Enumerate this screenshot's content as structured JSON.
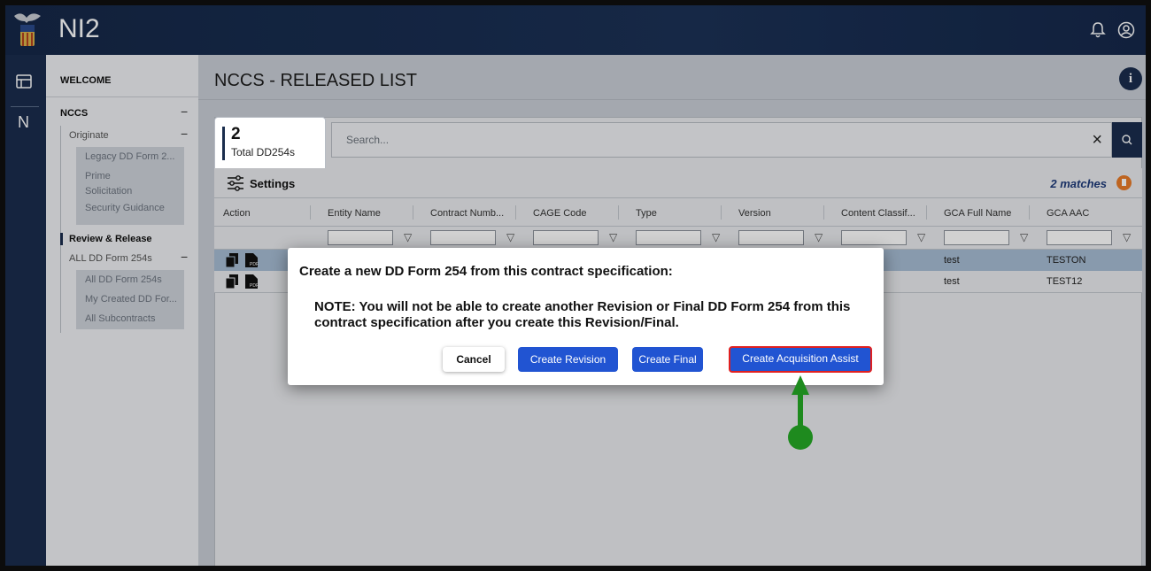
{
  "app": {
    "brand": "NI2"
  },
  "sidebar": {
    "welcome": "WELCOME",
    "nccs": "NCCS",
    "originate": "Originate",
    "originate_items": [
      "Legacy DD Form 2...",
      "Prime",
      "Solicitation",
      "Security Guidance"
    ],
    "review": "Review & Release",
    "all_dd": "ALL DD Form 254s",
    "all_dd_items": [
      "All DD Form 254s",
      "My Created DD For...",
      "All Subcontracts"
    ],
    "rail_letter": "N"
  },
  "main": {
    "title": "NCCS - RELEASED LIST",
    "info": "i",
    "count": "2",
    "count_label": "Total DD254s",
    "search_placeholder": "Search...",
    "clear": "×",
    "settings": "Settings",
    "matches": "2 matches"
  },
  "table": {
    "headers": [
      "Action",
      "Entity Name",
      "Contract Numb...",
      "CAGE Code",
      "Type",
      "Version",
      "Content Classif...",
      "GCA Full Name",
      "GCA AAC"
    ],
    "rows": [
      {
        "gca_full_name": "test",
        "gca_aac": "TESTON"
      },
      {
        "gca_full_name": "test",
        "gca_aac": "TEST12"
      }
    ]
  },
  "modal": {
    "heading": "Create a new DD Form 254 from this contract specification:",
    "note": "NOTE: You will not be able to create another Revision or Final DD Form 254 from this contract specification after you create this Revision/Final.",
    "cancel": "Cancel",
    "create_revision": "Create Revision",
    "create_final": "Create Final",
    "create_acquisition": "Create Acquisition Assist"
  },
  "colors": {
    "nav": "#1a2d4d",
    "primary_button": "#2154d2",
    "highlight": "#e02020",
    "arrow": "#1e8a1e"
  }
}
